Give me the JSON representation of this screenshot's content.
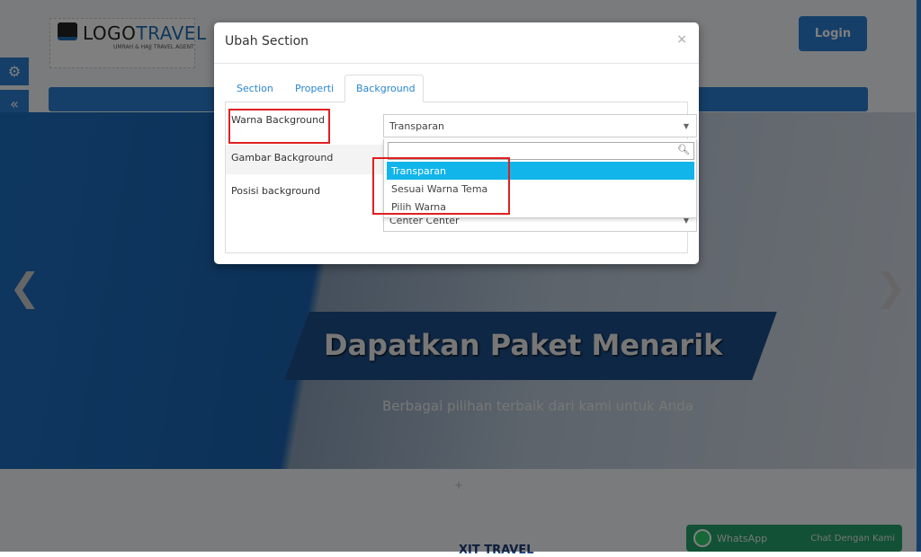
{
  "page": {
    "logo": {
      "text_a": "LOGO",
      "text_b": "TRAVEL",
      "tagline": "UMRAH & HAJJ TRAVEL AGENT"
    },
    "login_label": "Login",
    "hero": {
      "title": "Dapatkan Paket Menarik",
      "subtitle": "Berbagai pilihan terbaik dari kami untuk Anda"
    },
    "section2_title": "XIT TRAVEL",
    "whatsapp": {
      "label": "WhatsApp",
      "cta": "Chat Dengan Kami"
    },
    "colors": {
      "primary": "#2a7fd0",
      "whatsapp": "#25a26a"
    }
  },
  "modal": {
    "title": "Ubah Section",
    "close": "×",
    "tabs": [
      {
        "label": "Section"
      },
      {
        "label": "Properti"
      },
      {
        "label": "Background",
        "active": true
      }
    ],
    "fields": [
      {
        "label": "Warna Background",
        "value": "Transparan"
      },
      {
        "label": "Gambar Background"
      },
      {
        "label": "Posisi background",
        "value": "Center Center"
      }
    ],
    "dropdown": {
      "search_value": "",
      "options": [
        "Transparan",
        "Sesuai Warna Tema",
        "Pilih Warna"
      ],
      "highlighted": "Transparan"
    },
    "colors": {
      "highlight": "#12b5ea",
      "annotation": "#e02020"
    }
  }
}
